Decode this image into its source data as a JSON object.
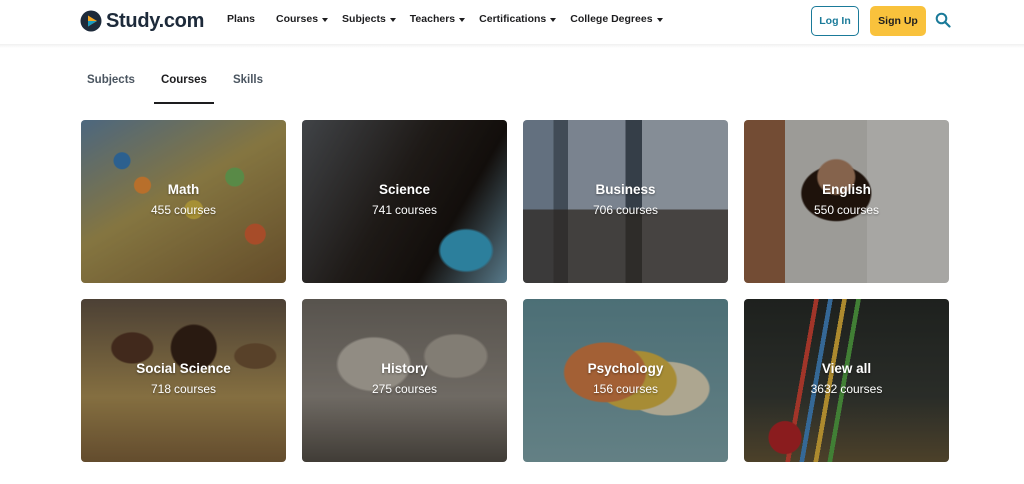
{
  "brand": {
    "name": "Study.com"
  },
  "nav": {
    "items": [
      {
        "label": "Plans",
        "dropdown": false
      },
      {
        "label": "Courses",
        "dropdown": true
      },
      {
        "label": "Subjects",
        "dropdown": true
      },
      {
        "label": "Teachers",
        "dropdown": true
      },
      {
        "label": "Certifications",
        "dropdown": true
      },
      {
        "label": "College Degrees",
        "dropdown": true
      }
    ],
    "login_label": "Log In",
    "signup_label": "Sign Up"
  },
  "tabs": [
    {
      "label": "Subjects",
      "active": false
    },
    {
      "label": "Courses",
      "active": true
    },
    {
      "label": "Skills",
      "active": false
    }
  ],
  "cards": [
    {
      "title": "Math",
      "count": "455",
      "unit": "courses"
    },
    {
      "title": "Science",
      "count": "741",
      "unit": "courses"
    },
    {
      "title": "Business",
      "count": "706",
      "unit": "courses"
    },
    {
      "title": "English",
      "count": "550",
      "unit": "courses"
    },
    {
      "title": "Social Science",
      "count": "718",
      "unit": "courses"
    },
    {
      "title": "History",
      "count": "275",
      "unit": "courses"
    },
    {
      "title": "Psychology",
      "count": "156",
      "unit": "courses"
    },
    {
      "title": "View all",
      "count": "3632",
      "unit": "courses"
    }
  ],
  "colors": {
    "login_border": "#1a7a99",
    "signup_bg": "#f9c23c",
    "logo_orange": "#f5a623",
    "logo_teal": "#1a7a99"
  }
}
